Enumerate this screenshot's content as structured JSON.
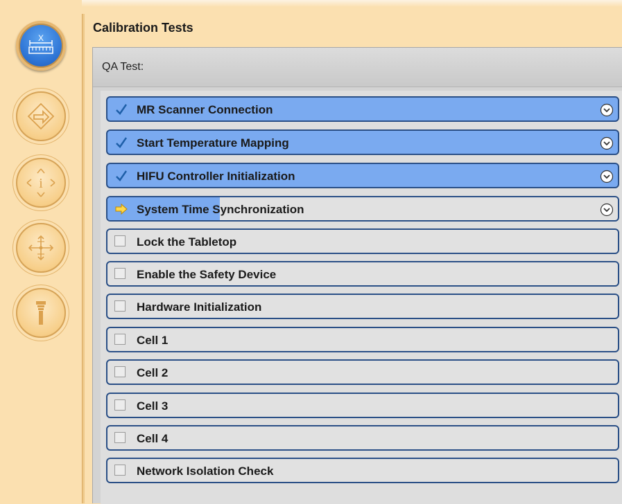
{
  "window": {
    "title": "Calibration Tests",
    "colors": {
      "background": "#fbe0b0",
      "active_blue": "#2f76d6",
      "step_done": "#7aaaf0",
      "step_pending": "#e1e1e1",
      "step_border": "#2a4f86",
      "check": "#1e5fa8",
      "arrow": "#f2b400"
    }
  },
  "sidebar": {
    "buttons": [
      {
        "name": "calibration",
        "icon": "ruler-x-icon",
        "active": true,
        "glyph": "X"
      },
      {
        "name": "treatment",
        "icon": "arrow-diamond-icon",
        "active": false
      },
      {
        "name": "info",
        "icon": "info-diamond-icon",
        "active": false,
        "glyph": "i"
      },
      {
        "name": "positioning",
        "icon": "crosshair-arrows-icon",
        "active": false
      },
      {
        "name": "transducer",
        "icon": "transducer-icon",
        "active": false
      }
    ]
  },
  "panel": {
    "header_label": "QA Test:"
  },
  "steps": [
    {
      "label": "MR Scanner Connection",
      "status": "done",
      "progress": 1.0,
      "icon": "checkmark-icon",
      "expand_icon": "chevron-down-circle-icon"
    },
    {
      "label": "Start Temperature Mapping",
      "status": "done",
      "progress": 1.0,
      "icon": "checkmark-icon",
      "expand_icon": "chevron-down-circle-icon"
    },
    {
      "label": "HIFU Controller Initialization",
      "status": "done",
      "progress": 1.0,
      "icon": "checkmark-icon",
      "expand_icon": "chevron-down-circle-icon"
    },
    {
      "label": "System Time Synchronization",
      "status": "in_progress",
      "progress": 0.22,
      "icon": "arrow-right-icon",
      "expand_icon": "chevron-down-circle-icon"
    },
    {
      "label": "Lock the Tabletop",
      "status": "pending",
      "progress": 0,
      "icon": "checkbox-icon"
    },
    {
      "label": "Enable the Safety Device",
      "status": "pending",
      "progress": 0,
      "icon": "checkbox-icon"
    },
    {
      "label": "Hardware Initialization",
      "status": "pending",
      "progress": 0,
      "icon": "checkbox-icon"
    },
    {
      "label": "Cell 1",
      "status": "pending",
      "progress": 0,
      "icon": "checkbox-icon"
    },
    {
      "label": "Cell 2",
      "status": "pending",
      "progress": 0,
      "icon": "checkbox-icon"
    },
    {
      "label": "Cell 3",
      "status": "pending",
      "progress": 0,
      "icon": "checkbox-icon"
    },
    {
      "label": "Cell 4",
      "status": "pending",
      "progress": 0,
      "icon": "checkbox-icon"
    },
    {
      "label": "Network Isolation Check",
      "status": "pending",
      "progress": 0,
      "icon": "checkbox-icon"
    }
  ]
}
